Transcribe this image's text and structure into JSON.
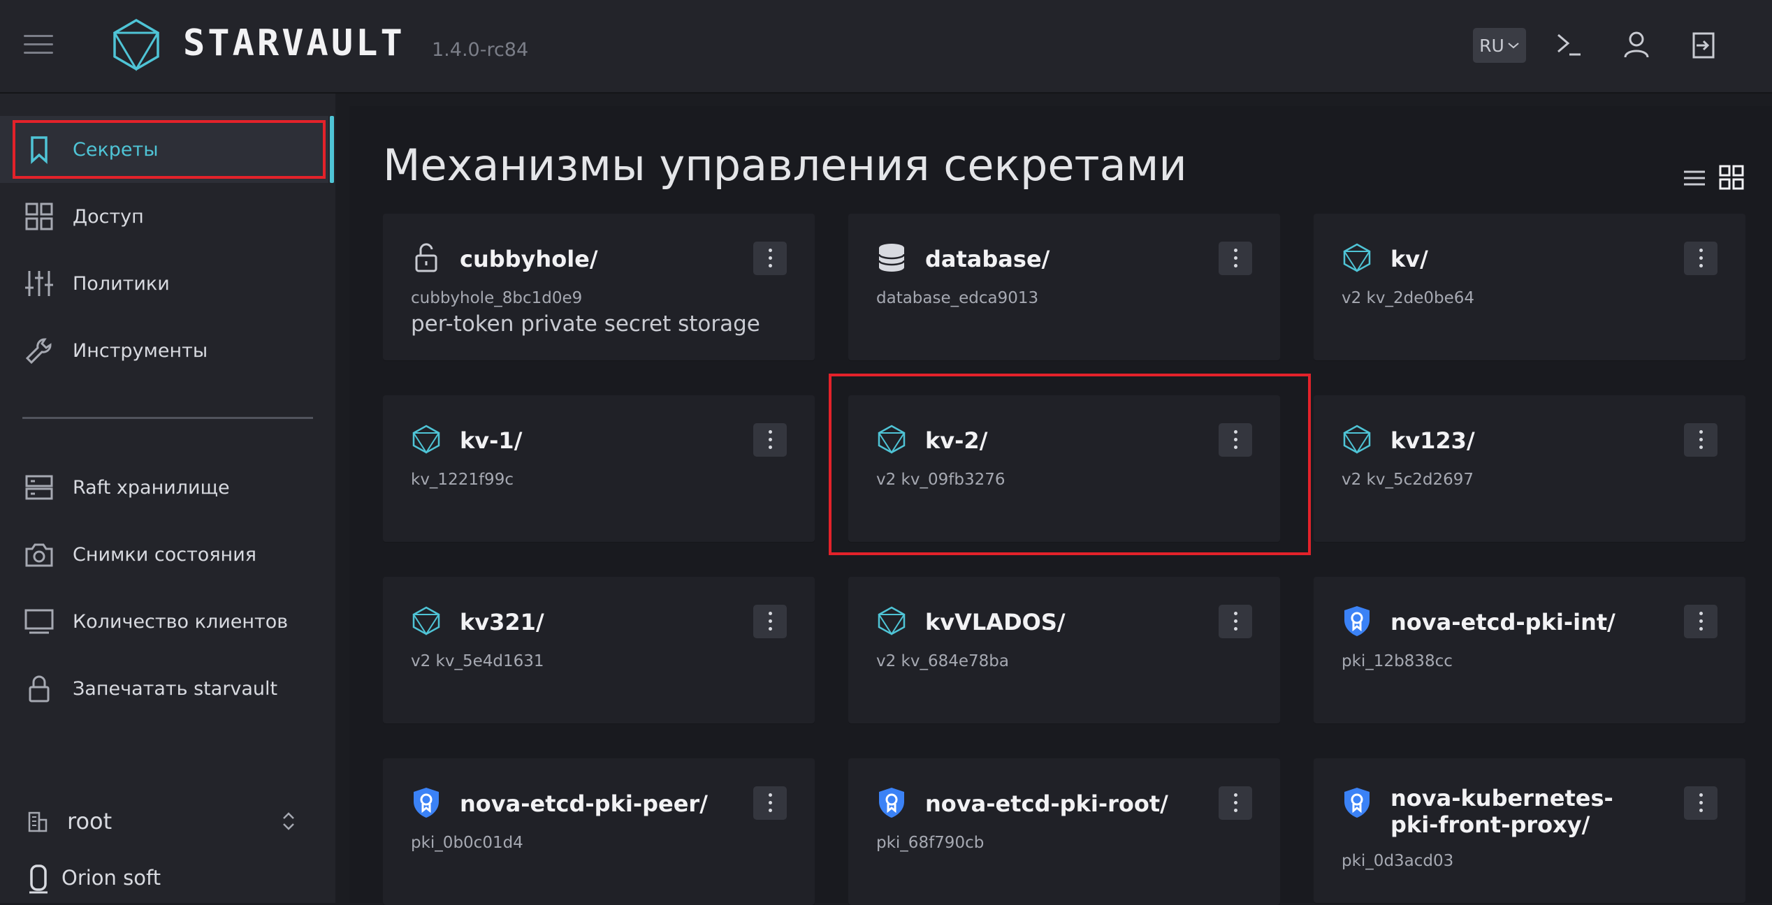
{
  "app": {
    "logo_text": "STARVAULT",
    "version": "1.4.0-rc84",
    "language": "RU"
  },
  "sidebar": {
    "items": [
      {
        "label": "Секреты",
        "icon": "bookmark-icon",
        "active": true
      },
      {
        "label": "Доступ",
        "icon": "grid-icon"
      },
      {
        "label": "Политики",
        "icon": "sliders-icon"
      },
      {
        "label": "Инструменты",
        "icon": "wrench-icon"
      }
    ],
    "secondary_items": [
      {
        "label": "Raft хранилище",
        "icon": "server-icon"
      },
      {
        "label": "Снимки состояния",
        "icon": "camera-icon"
      },
      {
        "label": "Количество клиентов",
        "icon": "monitor-icon"
      },
      {
        "label": "Запечатать starvault",
        "icon": "lock-icon"
      }
    ],
    "namespace": "root",
    "organization": "Orion soft",
    "accent_color": "#4fc4d6"
  },
  "main": {
    "title": "Механизмы управления секретами",
    "cards": [
      {
        "title": "cubbyhole/",
        "subtitle": "cubbyhole_8bc1d0e9",
        "description": "per-token private secret storage",
        "icon": "unlock-icon"
      },
      {
        "title": "database/",
        "subtitle": "database_edca9013",
        "icon": "database-icon"
      },
      {
        "title": "kv/",
        "subtitle": "v2 kv_2de0be64",
        "icon": "kv-icon"
      },
      {
        "title": "kv-1/",
        "subtitle": "kv_1221f99c",
        "icon": "kv-icon"
      },
      {
        "title": "kv-2/",
        "subtitle": "v2 kv_09fb3276",
        "icon": "kv-icon"
      },
      {
        "title": "kv123/",
        "subtitle": "v2 kv_5c2d2697",
        "icon": "kv-icon"
      },
      {
        "title": "kv321/",
        "subtitle": "v2 kv_5e4d1631",
        "icon": "kv-icon"
      },
      {
        "title": "kvVLADOS/",
        "subtitle": "v2 kv_684e78ba",
        "icon": "kv-icon"
      },
      {
        "title": "nova-etcd-pki-int/",
        "subtitle": "pki_12b838cc",
        "icon": "certificate-shield-icon"
      },
      {
        "title": "nova-etcd-pki-peer/",
        "subtitle": "pki_0b0c01d4",
        "icon": "certificate-shield-icon"
      },
      {
        "title": "nova-etcd-pki-root/",
        "subtitle": "pki_68f790cb",
        "icon": "certificate-shield-icon"
      },
      {
        "title": "nova-kubernetes-pki-front-proxy/",
        "subtitle": "pki_0d3acd03",
        "icon": "certificate-shield-icon"
      }
    ]
  },
  "colors": {
    "highlight": "#e3222a",
    "pki_blue": "#3b82f6"
  }
}
